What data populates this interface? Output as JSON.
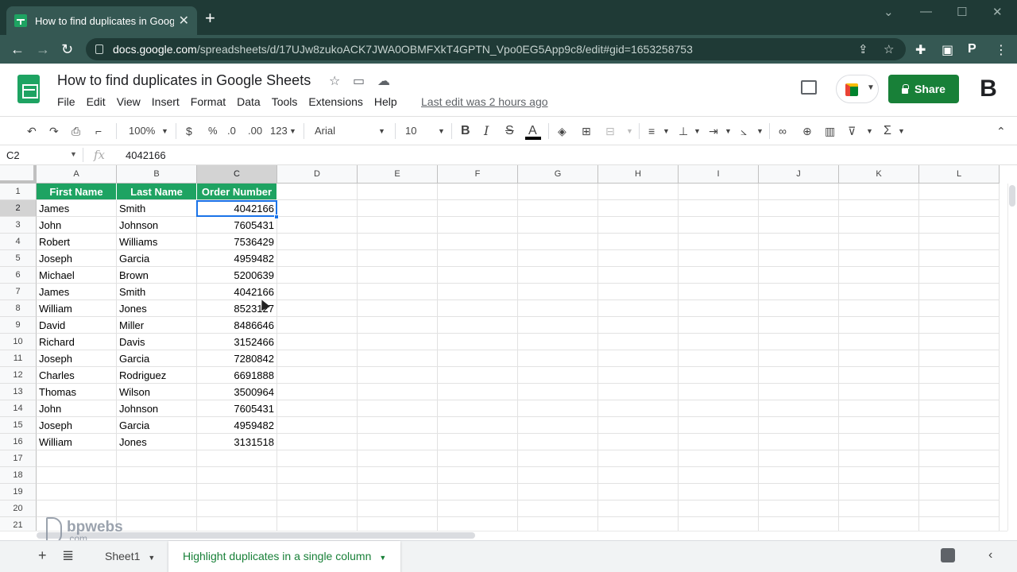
{
  "browser": {
    "tab_title": "How to find duplicates in Google Sheets",
    "tab_close": "✕",
    "new_tab": "+",
    "url_host": "docs.google.com",
    "url_path": "/spreadsheets/d/17UJw8zukoACK7JWA0OBMFXkT4GPTN_Vpo0EG5App9c8/edit#gid=1653258753",
    "icons": [
      "back-icon",
      "forward-icon",
      "reload-icon",
      "lock-icon",
      "share-page-icon",
      "bookmark-star-icon",
      "extensions-icon",
      "side-panel-icon",
      "profile-icon",
      "menu-icon"
    ]
  },
  "doc": {
    "title": "How to find duplicates in Google Sheets",
    "menu": [
      "File",
      "Edit",
      "View",
      "Insert",
      "Format",
      "Data",
      "Tools",
      "Extensions",
      "Help"
    ],
    "last_edit": "Last edit was 2 hours ago",
    "share_label": "Share",
    "avatar": "B"
  },
  "toolbar": {
    "zoom": "100%",
    "currency": "$",
    "percent": "%",
    "dec_decrease": ".0",
    "dec_increase": ".00",
    "more_formats": "123",
    "font": "Arial",
    "font_size": "10",
    "bold": "B",
    "italic": "I",
    "strike": "S",
    "text_color": "A",
    "sum": "Σ",
    "text_color_hex": "#000000"
  },
  "formula_bar": {
    "cell_ref": "C2",
    "fx": "fx",
    "value": "4042166"
  },
  "grid": {
    "columns": [
      "A",
      "B",
      "C",
      "D",
      "E",
      "F",
      "G",
      "H",
      "I",
      "J",
      "K",
      "L"
    ],
    "rows": [
      "1",
      "2",
      "3",
      "4",
      "5",
      "6",
      "7",
      "8",
      "9",
      "10",
      "11",
      "12",
      "13",
      "14",
      "15",
      "16",
      "17",
      "18",
      "19",
      "20",
      "21"
    ],
    "header": [
      "First Name",
      "Last Name",
      "Order Number"
    ],
    "data": [
      [
        "James",
        "Smith",
        "4042166"
      ],
      [
        "John",
        "Johnson",
        "7605431"
      ],
      [
        "Robert",
        "Williams",
        "7536429"
      ],
      [
        "Joseph",
        "Garcia",
        "4959482"
      ],
      [
        "Michael",
        "Brown",
        "5200639"
      ],
      [
        "James",
        "Smith",
        "4042166"
      ],
      [
        "William",
        "Jones",
        "8523127"
      ],
      [
        "David",
        "Miller",
        "8486646"
      ],
      [
        "Richard",
        "Davis",
        "3152466"
      ],
      [
        "Joseph",
        "Garcia",
        "7280842"
      ],
      [
        "Charles",
        "Rodriguez",
        "6691888"
      ],
      [
        "Thomas",
        "Wilson",
        "3500964"
      ],
      [
        "John",
        "Johnson",
        "7605431"
      ],
      [
        "Joseph",
        "Garcia",
        "4959482"
      ],
      [
        "William",
        "Jones",
        "3131518"
      ]
    ],
    "header_color": "#1ea362",
    "selected_cell": "C2"
  },
  "sheets": {
    "add": "+",
    "tabs": [
      "Sheet1",
      "Highlight duplicates in a single column"
    ],
    "active_tab": "Highlight duplicates in a single column"
  },
  "watermark": {
    "brand": "bpwebs",
    "suffix": ".com"
  }
}
